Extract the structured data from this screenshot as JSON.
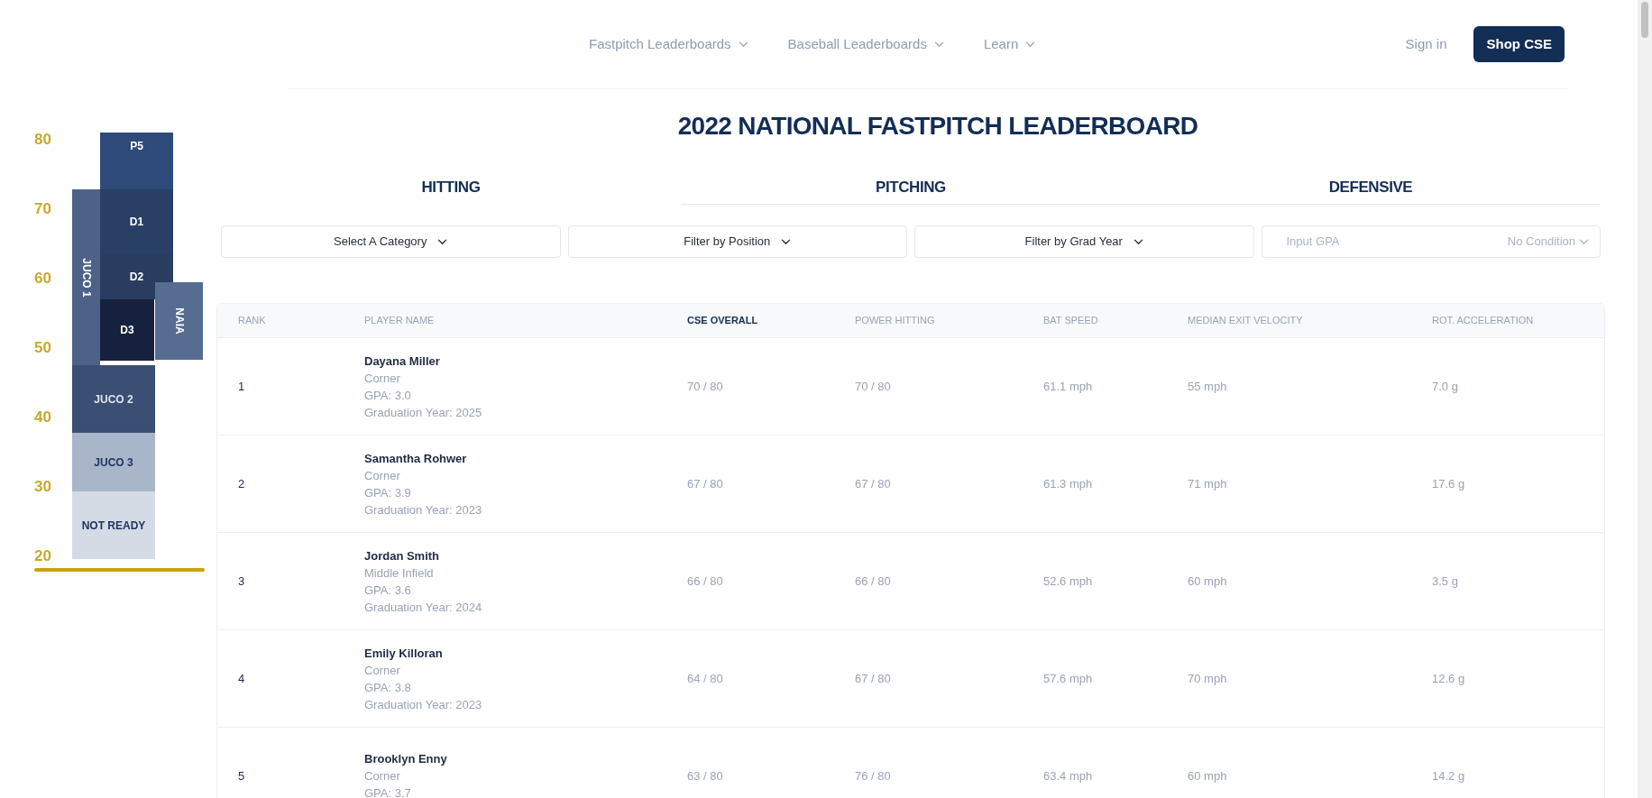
{
  "nav": {
    "items": [
      {
        "label": "Fastpitch Leaderboards"
      },
      {
        "label": "Baseball Leaderboards"
      },
      {
        "label": "Learn"
      }
    ],
    "sign_in": "Sign in",
    "shop": "Shop CSE"
  },
  "scale_graphic": {
    "ticks": [
      "80",
      "70",
      "60",
      "50",
      "40",
      "30",
      "20"
    ],
    "levels": [
      {
        "label": "P5",
        "kind": "top"
      },
      {
        "label": "D1",
        "kind": "column"
      },
      {
        "label": "D2",
        "kind": "column"
      },
      {
        "label": "D3",
        "kind": "column"
      },
      {
        "label": "JUCO 1",
        "kind": "vertical"
      },
      {
        "label": "NAIA",
        "kind": "vertical"
      },
      {
        "label": "JUCO 2",
        "kind": "low"
      },
      {
        "label": "JUCO 3",
        "kind": "low"
      },
      {
        "label": "NOT READY",
        "kind": "low"
      }
    ]
  },
  "title": "2022 NATIONAL FASTPITCH LEADERBOARD",
  "tabs": [
    {
      "label": "HITTING",
      "selected": true
    },
    {
      "label": "PITCHING",
      "selected": false
    },
    {
      "label": "DEFENSIVE",
      "selected": false
    }
  ],
  "filters": [
    {
      "label": "Select A Category"
    },
    {
      "label": "Filter by Position"
    },
    {
      "label": "Filter by Grad Year"
    }
  ],
  "gpa": {
    "placeholder": "Input GPA",
    "condition": "No Condition"
  },
  "table": {
    "columns": [
      {
        "label": "RANK",
        "sorted": false
      },
      {
        "label": "PLAYER NAME",
        "sorted": false
      },
      {
        "label": "CSE OVERALL",
        "sorted": true
      },
      {
        "label": "POWER HITTING",
        "sorted": false
      },
      {
        "label": "BAT SPEED",
        "sorted": false
      },
      {
        "label": "MEDIAN EXIT VELOCITY",
        "sorted": false
      },
      {
        "label": "ROT. ACCELERATION",
        "sorted": false
      }
    ],
    "rows": [
      {
        "rank": "1",
        "name": "Dayana Miller",
        "details": [
          "Corner",
          "GPA: 3.0",
          "Graduation Year: 2025"
        ],
        "values": [
          "70 / 80",
          "70 / 80",
          "61.1 mph",
          "55 mph",
          "7.0 g"
        ]
      },
      {
        "rank": "2",
        "name": "Samantha Rohwer",
        "details": [
          "Corner",
          "GPA: 3.9",
          "Graduation Year: 2023"
        ],
        "values": [
          "67 / 80",
          "67 / 80",
          "61.3 mph",
          "71 mph",
          "17.6 g"
        ]
      },
      {
        "rank": "3",
        "name": "Jordan Smith",
        "details": [
          "Middle Infield",
          "GPA: 3.6",
          "Graduation Year: 2024"
        ],
        "values": [
          "66 / 80",
          "66 / 80",
          "52.6 mph",
          "60 mph",
          "3.5 g"
        ]
      },
      {
        "rank": "4",
        "name": "Emily Killoran",
        "details": [
          "Corner",
          "GPA: 3.8",
          "Graduation Year: 2023"
        ],
        "values": [
          "64 / 80",
          "67 / 80",
          "57.6 mph",
          "70 mph",
          "12.6 g"
        ]
      },
      {
        "rank": "5",
        "name": "Brooklyn Enny",
        "details": [
          "Corner",
          "GPA: 3.7"
        ],
        "values": [
          "63 / 80",
          "76 / 80",
          "63.4 mph",
          "60 mph",
          "14.2 g"
        ]
      }
    ]
  }
}
